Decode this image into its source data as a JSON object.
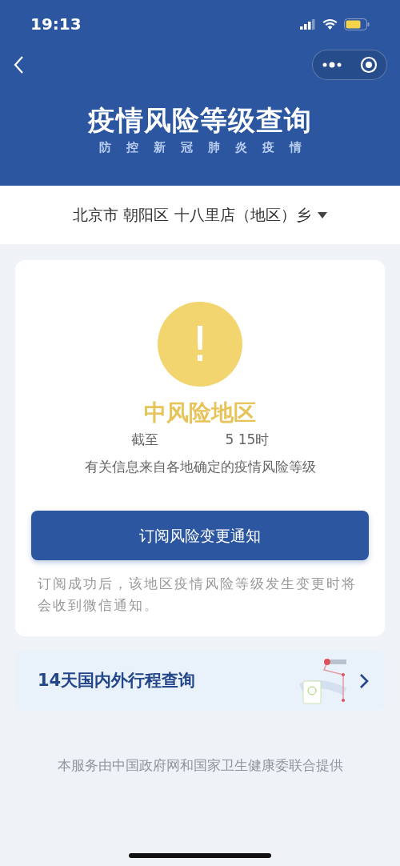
{
  "status_bar": {
    "time": "19:13"
  },
  "header": {
    "title": "疫情风险等级查询",
    "subtitle": [
      "防",
      "控",
      "新",
      "冠",
      "肺",
      "炎",
      "疫",
      "情"
    ]
  },
  "location": {
    "text": "北京市 朝阳区 十八里店（地区）乡"
  },
  "result": {
    "symbol": "!",
    "level": "中风险地区",
    "time_parts": [
      "截至",
      "5 15时"
    ],
    "info": "有关信息来自各地确定的疫情风险等级"
  },
  "subscribe_button": "订阅风险变更通知",
  "note": "订阅成功后，该地区疫情风险等级发生变更时将会收到微信通知。",
  "trip_card": {
    "title": "14天国内外行程查询"
  },
  "footer": "本服务由中国政府网和国家卫生健康委联合提供"
}
